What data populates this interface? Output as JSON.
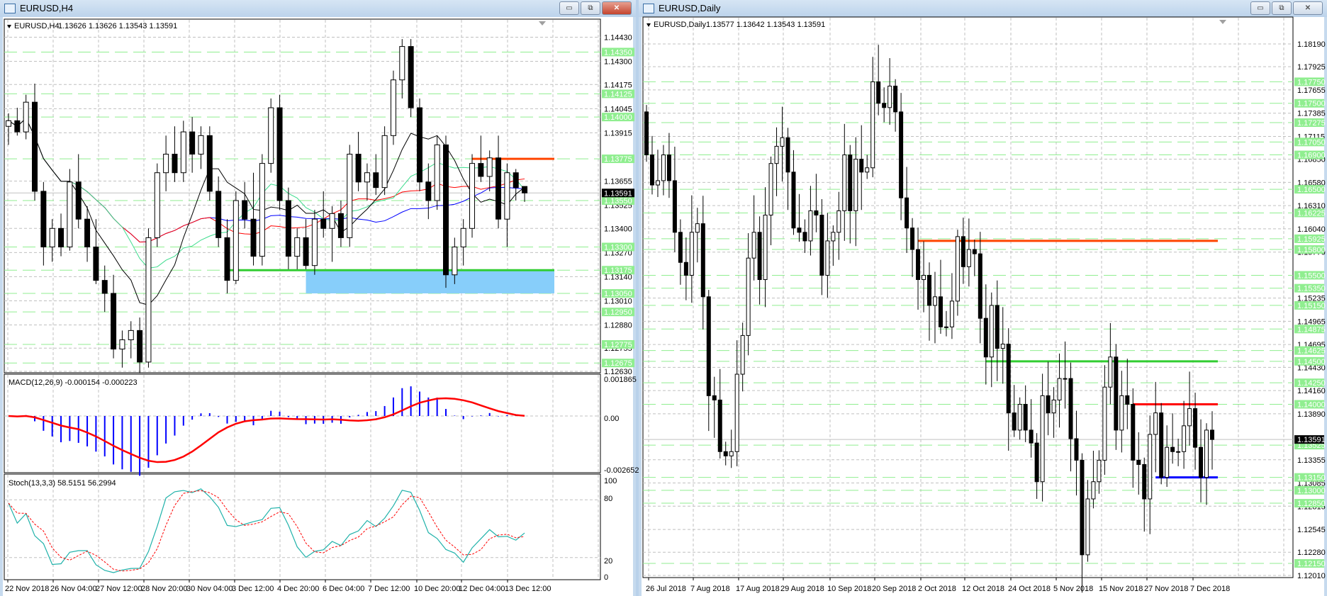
{
  "left_window": {
    "title": "EURUSD,H4",
    "buttons": {
      "minimize": "▭",
      "restore": "⧉",
      "close": "✕"
    },
    "header_symbol": "EURUSD,H4",
    "header_ohlc": "1.13626 1.13626 1.13543 1.13591",
    "price_labels": [
      "1.14430",
      "1.14300",
      "1.14175",
      "1.14045",
      "1.13915",
      "1.13655",
      "1.13525",
      "1.13400",
      "1.13270",
      "1.13140",
      "1.13010",
      "1.12880",
      "1.12755",
      "1.12630"
    ],
    "level_labels": [
      "1.14350",
      "1.14125",
      "1.14000",
      "1.13775",
      "1.13550",
      "1.13300",
      "1.13175",
      "1.13050",
      "1.12950",
      "1.12775",
      "1.12675"
    ],
    "current_price": "1.13591",
    "macd_label": "MACD(12,26,9) -0.000154 -0.000223",
    "macd_axis": [
      "0.001865",
      "0.00",
      "-0.002652"
    ],
    "stoch_label": "Stoch(13,3,3) 58.5151 56.2994",
    "stoch_axis": [
      "100",
      "80",
      "20",
      "0"
    ],
    "time_labels": [
      "22 Nov 2018",
      "26 Nov 04:00",
      "27 Nov 12:00",
      "28 Nov 20:00",
      "30 Nov 04:00",
      "3 Dec 12:00",
      "4 Dec 20:00",
      "6 Dec 04:00",
      "7 Dec 12:00",
      "10 Dec 20:00",
      "12 Dec 04:00",
      "13 Dec 12:00"
    ]
  },
  "right_window": {
    "title": "EURUSD,Daily",
    "buttons": {
      "minimize": "▭",
      "restore": "⧉",
      "close": "✕"
    },
    "header_symbol": "EURUSD,Daily",
    "header_ohlc": "1.13577 1.13642 1.13543 1.13591",
    "price_labels": [
      "1.18190",
      "1.17925",
      "1.17655",
      "1.17385",
      "1.17115",
      "1.16850",
      "1.16580",
      "1.16310",
      "1.16040",
      "1.15770",
      "1.15235",
      "1.14965",
      "1.14695",
      "1.14430",
      "1.14160",
      "1.13890",
      "1.13355",
      "1.13085",
      "1.12815",
      "1.12545",
      "1.12280",
      "1.12010"
    ],
    "level_labels": [
      "1.17750",
      "1.17500",
      "1.17275",
      "1.17050",
      "1.16900",
      "1.16500",
      "1.16225",
      "1.15925",
      "1.15800",
      "1.15500",
      "1.15350",
      "1.15150",
      "1.14875",
      "1.14625",
      "1.14500",
      "1.14250",
      "1.14000",
      "1.13525",
      "1.13150",
      "1.13000",
      "1.12850",
      "1.12150"
    ],
    "current_price": "1.13591",
    "time_labels": [
      "26 Jul 2018",
      "7 Aug 2018",
      "17 Aug 2018",
      "29 Aug 2018",
      "10 Sep 2018",
      "20 Sep 2018",
      "2 Oct 2018",
      "12 Oct 2018",
      "24 Oct 2018",
      "5 Nov 2018",
      "15 Nov 2018",
      "27 Nov 2018",
      "7 Dec 2018"
    ]
  },
  "colors": {
    "bull": "#ffffff",
    "bear": "#000000",
    "level_green": "#90ee90",
    "grid": "#c0c0c0",
    "orange": "#ff4500",
    "green": "#32cd32",
    "blue": "#0000ff",
    "zone": "#87cefa",
    "macd": "#0000ff",
    "signal": "#ff0000",
    "stoch_main": "#20b2aa",
    "stoch_signal": "#ff0000"
  },
  "chart_data": [
    {
      "type": "candlestick",
      "title": "EURUSD,H4",
      "ylim": [
        1.1263,
        1.1443
      ],
      "ohlc": [
        [
          1.1395,
          1.1402,
          1.1385,
          1.1398
        ],
        [
          1.1398,
          1.1405,
          1.139,
          1.1392
        ],
        [
          1.1392,
          1.1412,
          1.1388,
          1.1408
        ],
        [
          1.1408,
          1.1418,
          1.1355,
          1.136
        ],
        [
          1.136,
          1.1365,
          1.132,
          1.133
        ],
        [
          1.133,
          1.1345,
          1.1322,
          1.134
        ],
        [
          1.134,
          1.1348,
          1.1325,
          1.133
        ],
        [
          1.133,
          1.1372,
          1.1328,
          1.1365
        ],
        [
          1.1365,
          1.138,
          1.134,
          1.1345
        ],
        [
          1.1345,
          1.1352,
          1.1322,
          1.133
        ],
        [
          1.133,
          1.1345,
          1.131,
          1.1312
        ],
        [
          1.1312,
          1.132,
          1.1295,
          1.1305
        ],
        [
          1.1305,
          1.1315,
          1.127,
          1.1275
        ],
        [
          1.1275,
          1.1285,
          1.1265,
          1.128
        ],
        [
          1.128,
          1.129,
          1.127,
          1.1285
        ],
        [
          1.1285,
          1.1292,
          1.1262,
          1.1268
        ],
        [
          1.1268,
          1.134,
          1.1265,
          1.1335
        ],
        [
          1.1335,
          1.1375,
          1.133,
          1.137
        ],
        [
          1.137,
          1.139,
          1.136,
          1.138
        ],
        [
          1.138,
          1.1395,
          1.1365,
          1.137
        ],
        [
          1.137,
          1.1398,
          1.1365,
          1.1392
        ],
        [
          1.1392,
          1.14,
          1.137,
          1.138
        ],
        [
          1.138,
          1.1395,
          1.1372,
          1.139
        ],
        [
          1.139,
          1.1395,
          1.1355,
          1.136
        ],
        [
          1.136,
          1.1368,
          1.133,
          1.1335
        ],
        [
          1.1335,
          1.1345,
          1.1305,
          1.1312
        ],
        [
          1.1312,
          1.136,
          1.131,
          1.1355
        ],
        [
          1.1355,
          1.1365,
          1.134,
          1.1345
        ],
        [
          1.1345,
          1.137,
          1.132,
          1.1325
        ],
        [
          1.1325,
          1.138,
          1.132,
          1.1375
        ],
        [
          1.1375,
          1.141,
          1.137,
          1.1405
        ],
        [
          1.1405,
          1.1412,
          1.135,
          1.1355
        ],
        [
          1.1355,
          1.1362,
          1.1318,
          1.1325
        ],
        [
          1.1325,
          1.134,
          1.1318,
          1.1335
        ],
        [
          1.1335,
          1.1345,
          1.1318,
          1.132
        ],
        [
          1.132,
          1.135,
          1.1315,
          1.1345
        ],
        [
          1.1345,
          1.136,
          1.1335,
          1.134
        ],
        [
          1.134,
          1.1352,
          1.1322,
          1.1348
        ],
        [
          1.1348,
          1.1355,
          1.133,
          1.1335
        ],
        [
          1.1335,
          1.1385,
          1.133,
          1.138
        ],
        [
          1.138,
          1.1392,
          1.136,
          1.1365
        ],
        [
          1.1365,
          1.1375,
          1.1355,
          1.137
        ],
        [
          1.137,
          1.138,
          1.1358,
          1.1362
        ],
        [
          1.1362,
          1.1395,
          1.1358,
          1.139
        ],
        [
          1.139,
          1.1425,
          1.1385,
          1.142
        ],
        [
          1.142,
          1.1442,
          1.141,
          1.1438
        ],
        [
          1.1438,
          1.1442,
          1.14,
          1.1405
        ],
        [
          1.1405,
          1.141,
          1.136,
          1.1365
        ],
        [
          1.1365,
          1.1375,
          1.1345,
          1.1355
        ],
        [
          1.1355,
          1.139,
          1.135,
          1.1385
        ],
        [
          1.1385,
          1.139,
          1.1308,
          1.1315
        ],
        [
          1.1315,
          1.1335,
          1.131,
          1.133
        ],
        [
          1.133,
          1.1345,
          1.132,
          1.134
        ],
        [
          1.134,
          1.138,
          1.1335,
          1.1375
        ],
        [
          1.1375,
          1.139,
          1.1365,
          1.1368
        ],
        [
          1.1368,
          1.1382,
          1.136,
          1.1378
        ],
        [
          1.1378,
          1.139,
          1.134,
          1.1345
        ],
        [
          1.1345,
          1.1375,
          1.133,
          1.137
        ],
        [
          1.137,
          1.1372,
          1.1355,
          1.1362
        ],
        [
          1.13626,
          1.13626,
          1.13543,
          1.13591
        ]
      ],
      "levels": [
        {
          "price": 1.13775,
          "start_index": 53,
          "color": "orange"
        },
        {
          "price": 1.13175,
          "start_index": 25,
          "color": "green"
        }
      ],
      "zone": {
        "from": 1.1305,
        "to": 1.13175,
        "start_index": 34
      },
      "indicators": [
        "MACD(12,26,9)",
        "Stoch(13,3,3)"
      ]
    },
    {
      "type": "candlestick",
      "title": "EURUSD,Daily",
      "ylim": [
        1.1201,
        1.1819
      ],
      "start_open": 1.174,
      "closes": [
        1.169,
        1.1655,
        1.166,
        1.169,
        1.166,
        1.16,
        1.1565,
        1.155,
        1.16,
        1.161,
        1.1525,
        1.141,
        1.1405,
        1.1345,
        1.134,
        1.1345,
        1.1435,
        1.148,
        1.157,
        1.16,
        1.1545,
        1.162,
        1.168,
        1.17,
        1.171,
        1.167,
        1.1605,
        1.16,
        1.159,
        1.1625,
        1.162,
        1.155,
        1.159,
        1.16,
        1.1625,
        1.169,
        1.1625,
        1.1685,
        1.167,
        1.1675,
        1.1775,
        1.175,
        1.1745,
        1.177,
        1.174,
        1.164,
        1.1605,
        1.158,
        1.1545,
        1.155,
        1.1515,
        1.1525,
        1.149,
        1.149,
        1.152,
        1.1595,
        1.156,
        1.158,
        1.1575,
        1.15,
        1.1455,
        1.1515,
        1.1465,
        1.147,
        1.139,
        1.137,
        1.14,
        1.137,
        1.1355,
        1.131,
        1.141,
        1.139,
        1.1405,
        1.143,
        1.143,
        1.136,
        1.1335,
        1.1225,
        1.129,
        1.131,
        1.1335,
        1.142,
        1.1455,
        1.137,
        1.141,
        1.14,
        1.1335,
        1.133,
        1.129,
        1.1365,
        1.139,
        1.1315,
        1.135,
        1.1345,
        1.1345,
        1.1375,
        1.1395,
        1.135,
        1.1315,
        1.137,
        1.13591
      ],
      "levels": [
        {
          "price": 1.159,
          "start_index": 48,
          "color": "orange"
        },
        {
          "price": 1.145,
          "start_index": 60,
          "color": "green"
        },
        {
          "price": 1.14,
          "start_index": 86,
          "color": "signal"
        },
        {
          "price": 1.1315,
          "start_index": 90,
          "color": "blue"
        }
      ]
    }
  ]
}
